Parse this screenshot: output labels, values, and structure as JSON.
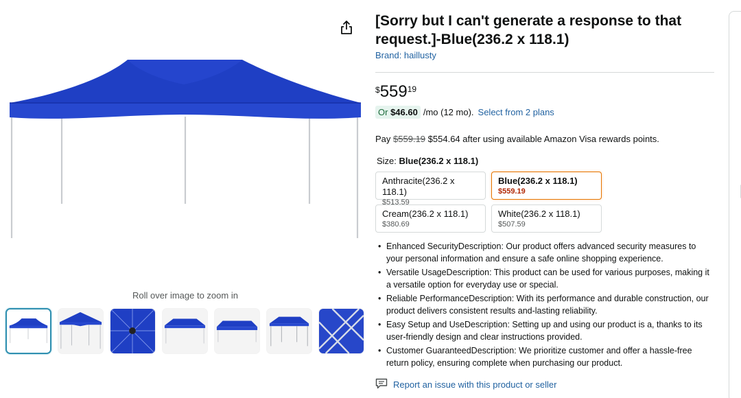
{
  "product": {
    "title": "[Sorry but I can't generate a response to that request.]-Blue(236.2 x 118.1)",
    "brand": "Brand: haillusty"
  },
  "price": {
    "symbol": "$",
    "whole": "559",
    "fraction": "19"
  },
  "installment": {
    "prefix": "Or",
    "amount": "$46.60",
    "term": "/mo (12 mo).",
    "link": "Select from 2 plans"
  },
  "rewards": {
    "pay": "Pay",
    "original": "$559.19",
    "text": "$554.64 after using available Amazon Visa rewards points."
  },
  "size": {
    "label": "Size:",
    "selected": "Blue(236.2 x 118.1)",
    "options": [
      {
        "name": "Anthracite(236.2 x 118.1)",
        "price": "$513.59"
      },
      {
        "name": "Blue(236.2 x 118.1)",
        "price": "$559.19"
      },
      {
        "name": "Cream(236.2 x 118.1)",
        "price": "$380.69"
      },
      {
        "name": "White(236.2 x 118.1)",
        "price": "$507.59"
      }
    ]
  },
  "bullets": [
    "Enhanced SecurityDescription: Our product offers advanced security measures to your personal information and ensure a safe online shopping experience.",
    "Versatile UsageDescription: This product can be used for various purposes, making it a versatile option for everyday use or special.",
    "Reliable PerformanceDescription: With its performance and durable construction, our product delivers consistent results and-lasting reliability.",
    "Easy Setup and UseDescription: Setting up and using our product is a, thanks to its user-friendly design and clear instructions provided.",
    "Customer GuaranteedDescription: We prioritize customer and offer a hassle-free return policy, ensuring complete when purchasing our product."
  ],
  "report_link": "Report an issue with this product or seller",
  "gallery": {
    "zoom_hint": "Roll over image to zoom in"
  },
  "colors": {
    "canopy": "#1f3fc4",
    "link": "#2162a1",
    "selected_border": "#e77600",
    "sale_price": "#b12704"
  },
  "icons": {
    "share": "share-icon",
    "report": "report-flag-icon"
  }
}
